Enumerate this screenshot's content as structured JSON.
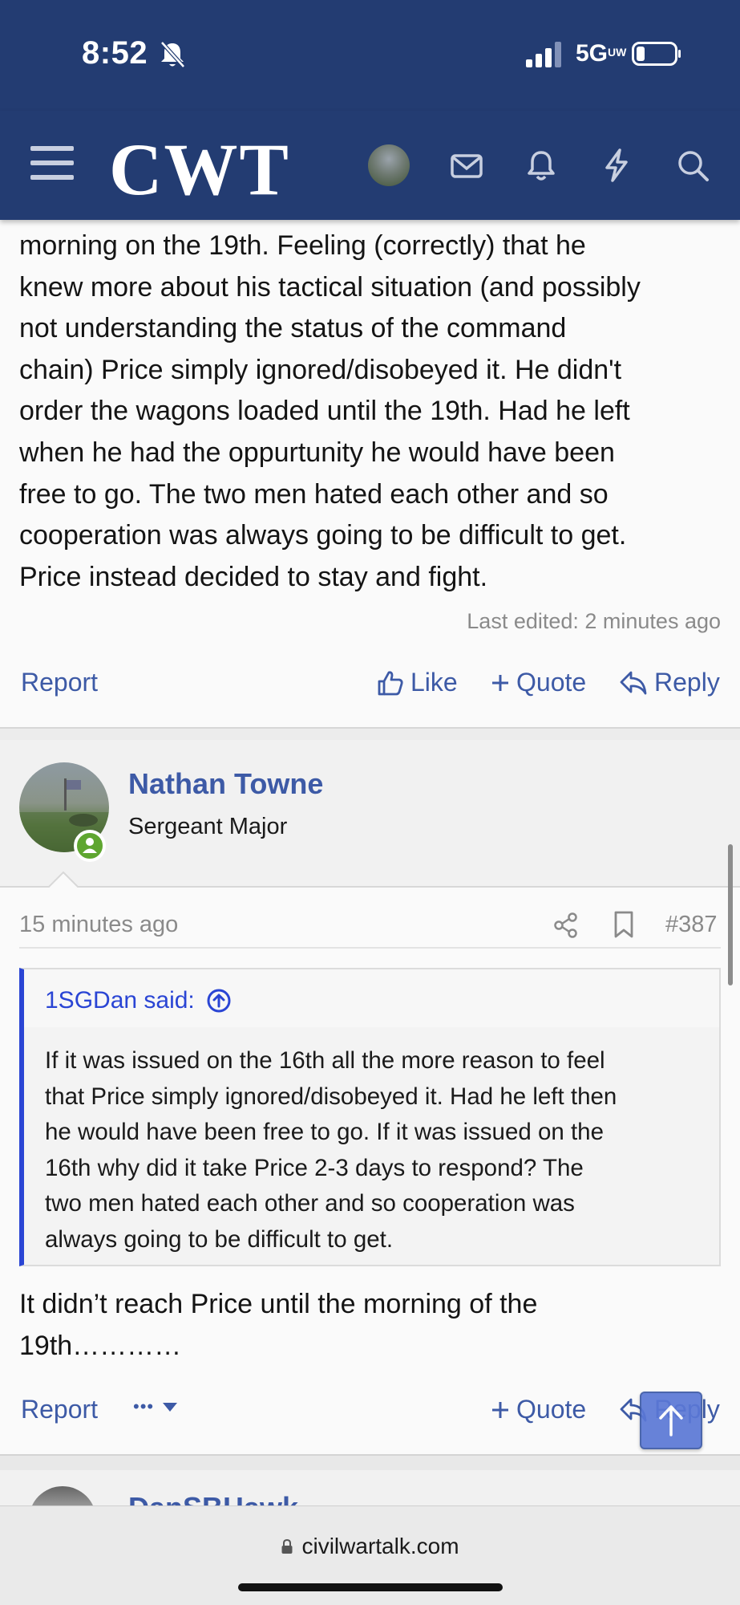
{
  "status_bar": {
    "time": "8:52",
    "network": "5G",
    "network_sup": "UW"
  },
  "header": {
    "logo": "CWT"
  },
  "post1": {
    "lines": [
      "morning on the 19th. Feeling (correctly) that he",
      "knew more about his tactical situation (and possibly",
      "not understanding the status of the command",
      "chain) Price simply ignored/disobeyed it. He didn't",
      "order the wagons loaded until the 19th. Had he left",
      "when he had the oppurtunity he would have been",
      "free to go. The two men hated each other and so",
      "cooperation was always going to be difficult to get.",
      "Price instead decided to stay and fight."
    ],
    "last_edited": "Last edited: 2 minutes ago",
    "report": "Report",
    "like": "Like",
    "quote": "Quote",
    "reply": "Reply"
  },
  "post2": {
    "username": "Nathan Towne",
    "user_title": "Sergeant Major",
    "time": "15 minutes ago",
    "post_number": "#387",
    "quote": {
      "author": "1SGDan said:",
      "lines": [
        "If it was issued on the 16th all the more reason to feel",
        "that Price simply ignored/disobeyed it. Had he left then",
        "he would have been free to go. If it was issued on the",
        "16th why did it take Price 2-3 days to respond? The",
        "two men hated each other and so cooperation was",
        "always going to be difficult to get."
      ]
    },
    "body_lines": [
      "It didn’t reach Price until the morning of the",
      "19th…………"
    ],
    "report": "Report",
    "more": "•••",
    "quote_label": "Quote",
    "reply": "Reply"
  },
  "next_post": {
    "username": "DanSBHawk"
  },
  "browser": {
    "url": "civilwartalk.com"
  },
  "colors": {
    "header": "#233c72",
    "link": "#3d5aa6",
    "quote_accent": "#2a45d4",
    "online": "#5fa630"
  }
}
